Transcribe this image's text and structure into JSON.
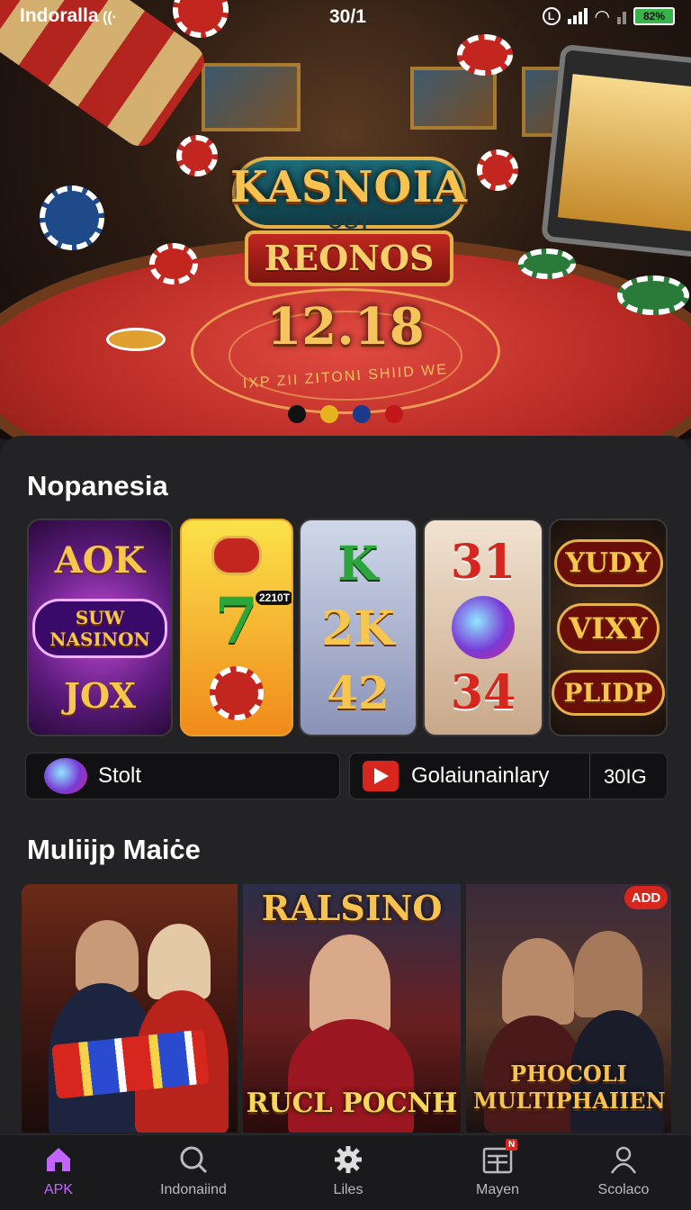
{
  "status_bar": {
    "carrier": "Indoralla",
    "carrier_icon": "sim-wifi-icon",
    "time": "30/1",
    "battery": "82%",
    "circle_label": "L"
  },
  "hero": {
    "logo_line1": "KASNOIA",
    "logo_line2": "OGT",
    "logo_line3": "REONOS",
    "jackpot": "12.18",
    "table_text": "IXP ZII ZITONI SHIID WE",
    "dots": [
      "#111111",
      "#e6b31e",
      "#1b3a8a",
      "#c2171c"
    ]
  },
  "section1": {
    "title": "Nopanesia",
    "tiles": [
      {
        "top": "AOK",
        "mid": "SUW NASINON",
        "bottom": "JOX"
      },
      {
        "top": "",
        "mid": "7",
        "badge": "2210T",
        "bottom": ""
      },
      {
        "top": "K",
        "mid": "2K",
        "bottom": "42"
      },
      {
        "top": "31",
        "mid": "",
        "bottom": "34"
      },
      {
        "top": "YUDY",
        "mid": "VIXY",
        "bottom": "PLIDP"
      }
    ],
    "bar_left": {
      "label": "Stolt",
      "icon": "orb-icon"
    },
    "bar_right": {
      "label": "Golaiunainlary",
      "value": "30IG",
      "icon": "play-icon"
    }
  },
  "section2": {
    "title": "Muliijp Maiċe",
    "cards": [
      {
        "title": ""
      },
      {
        "title": "RALSINO",
        "caption": "RUCL POCNH"
      },
      {
        "title": "PHOCOLI MULTIPHAIIEN",
        "badge": "ADD"
      }
    ]
  },
  "nav": {
    "items": [
      {
        "label": "APK",
        "icon": "home-icon",
        "active": true
      },
      {
        "label": "Indonaiind",
        "icon": "search-icon"
      },
      {
        "label": "Liles",
        "icon": "gear-icon"
      },
      {
        "label": "Mayen",
        "icon": "list-icon",
        "badge": "N"
      },
      {
        "label": "Scolaco",
        "icon": "user-icon"
      }
    ]
  },
  "colors": {
    "accent": "#c266ff",
    "brand_red": "#d7261e",
    "gold": "#f6c350"
  }
}
